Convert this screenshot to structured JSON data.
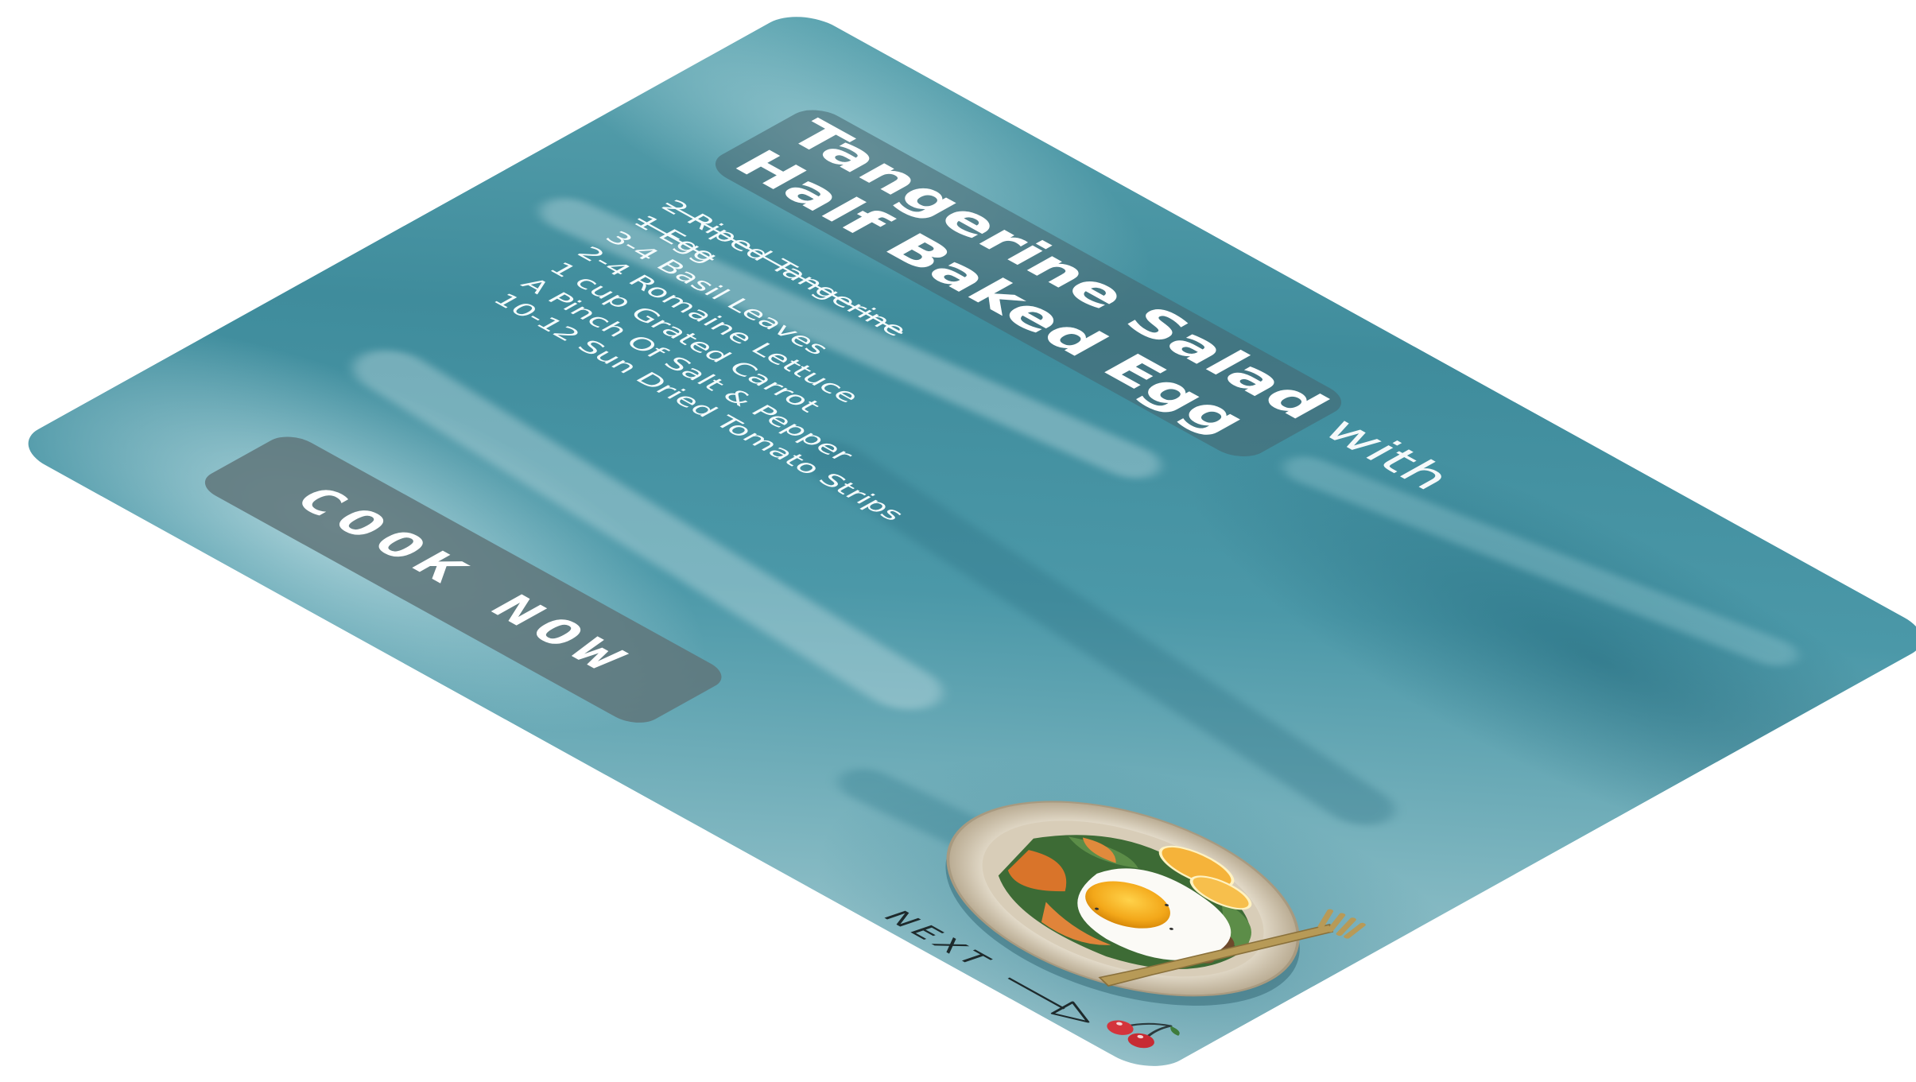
{
  "recipe": {
    "title_bold_1": "Tangerine Salad",
    "title_thin": "with",
    "title_bold_2": "Half Baked Egg"
  },
  "ingredients": [
    {
      "text": "2 Riped Tangerine",
      "checked": true
    },
    {
      "text": "1 Egg",
      "checked": true
    },
    {
      "text": "3-4 Basil Leaves",
      "checked": false
    },
    {
      "text": "2-4 Romaine Lettuce",
      "checked": false
    },
    {
      "text": "1 cup Grated Carrot",
      "checked": false
    },
    {
      "text": "A Pinch Of Salt & Pepper",
      "checked": false
    },
    {
      "text": "10-12 Sun Dried Tomato Strips",
      "checked": false
    }
  ],
  "actions": {
    "cook_label": "COOK NOW",
    "next_label": "NEXT"
  },
  "icons": {
    "brand": "cherry-icon",
    "next": "arrow-right-icon"
  },
  "colors": {
    "background_teal": "#4b98a8",
    "panel_overlay": "#46646e",
    "button_overlay": "#5f767a",
    "text_light": "#ffffff",
    "text_dark": "#1e2a2c",
    "cherry_red": "#d4343c"
  }
}
